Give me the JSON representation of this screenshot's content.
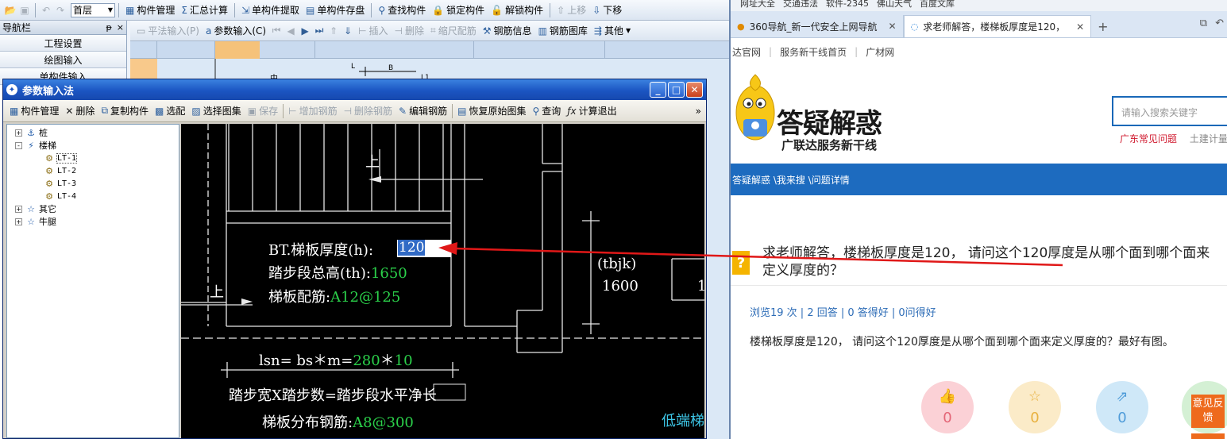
{
  "app": {
    "toolbar1": {
      "floor": "首层",
      "items": [
        "构件管理",
        "汇总计算",
        "单构件提取",
        "单构件存盘",
        "查找构件",
        "锁定构件",
        "解锁构件",
        "上移",
        "下移"
      ]
    },
    "toolbar2": {
      "items": [
        "平法输入(P)",
        "参数输入(C)",
        "插入",
        "删除",
        "缩尺配筋",
        "钢筋信息",
        "钢筋图库",
        "其他"
      ]
    },
    "nav": {
      "title": "导航栏",
      "pin": "ᵽ",
      "close": "×",
      "items": [
        "工程设置",
        "绘图输入",
        "单构件输入"
      ]
    }
  },
  "dialog": {
    "title": "参数输入法",
    "toolbar": [
      "构件管理",
      "删除",
      "复制构件",
      "选配",
      "选择图集",
      "保存",
      "增加钢筋",
      "删除钢筋",
      "编辑钢筋",
      "恢复原始图集",
      "查询",
      "计算退出"
    ],
    "more": "»",
    "tree": [
      {
        "label": "桩",
        "level": 0,
        "expander": "+"
      },
      {
        "label": "楼梯",
        "level": 0,
        "expander": "-"
      },
      {
        "label": "LT-1",
        "level": 1,
        "selected": true
      },
      {
        "label": "LT-2",
        "level": 1
      },
      {
        "label": "LT-3",
        "level": 1
      },
      {
        "label": "LT-4",
        "level": 1
      },
      {
        "label": "其它",
        "level": 0,
        "expander": "+"
      },
      {
        "label": "牛腿",
        "level": 0,
        "expander": "+"
      }
    ],
    "cad": {
      "up1": "上",
      "up2": "上",
      "thickness_label": "BT.梯板厚度(h):",
      "thickness_value": "120",
      "height_label": "踏步段总高(th):",
      "height_value": "1650",
      "rebar_label": "梯板配筋:",
      "rebar_value": "A12@125",
      "tbjk_label": "(tbjk)",
      "tbjk_value": "1600",
      "lsn_label": "lsn= bs＊m=",
      "bs_value": "280",
      "star": "＊",
      "m_value": "10",
      "formula": "踏步宽X踏步数=踏步段水平净长",
      "dist_label": "梯板分布钢筋:",
      "dist_value": "A8@300",
      "low_end": "低端梯",
      "top_l": "L",
      "top_b": "B",
      "top_l1": "L1",
      "top_h": "中",
      "right_1": "1"
    }
  },
  "browser": {
    "favbar": [
      "网址大全",
      "交通违法",
      "软件-2345",
      "佛山天气",
      "百度文库"
    ],
    "tabs": [
      {
        "label": "360导航_新一代安全上网导航",
        "active": false
      },
      {
        "label": "求老师解答，楼梯板厚度是120，",
        "active": true
      }
    ],
    "new_tab": "+",
    "site_links": [
      "达官网",
      "服务新干线首页",
      "广材网"
    ],
    "logo_title": "答疑解惑",
    "logo_sub": "广联达服务新干线",
    "search_placeholder": "请输入搜索关键字",
    "hot_links": [
      "广东常见问题",
      "土建计量"
    ],
    "breadcrumb": "答疑解惑 \\我来搜 \\问题详情",
    "question_badge": "?",
    "question": "求老师解答，楼梯板厚度是120， 请问这个120厚度是从哪个面到哪个面来定义厚度的？",
    "stats": "浏览19 次 | 2 回答 | 0 答得好 | 0问得好",
    "description": "楼梯板厚度是120， 请问这个120厚度是从哪个面到哪个面来定义厚度的？最好有图。",
    "votes": [
      "0",
      "0",
      "0"
    ],
    "feedback": "意见反馈"
  },
  "colors": {
    "accent_blue": "#1d6bbf",
    "cad_green": "#2bd04a",
    "arrow_red": "#e01818",
    "feedback_orange": "#ee6a1c"
  }
}
